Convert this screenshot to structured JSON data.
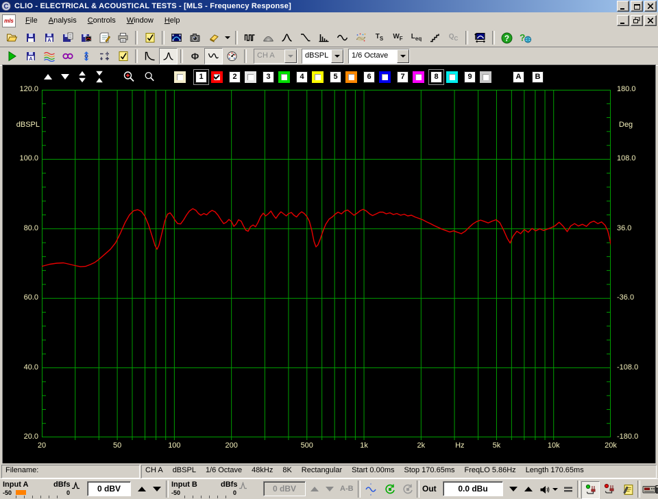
{
  "titlebar": {
    "title": "CLIO - ELECTRICAL & ACOUSTICAL TESTS - [MLS - Frequency Response]",
    "logo_glyph": "C"
  },
  "menu": {
    "window_icon_label": "mls",
    "items": [
      "File",
      "Analysis",
      "Controls",
      "Window",
      "Help"
    ]
  },
  "toolbar_main": {
    "save_a_letter": "A",
    "ts": {
      "main": "T",
      "sub": "S"
    },
    "wf": {
      "main": "W",
      "sub": "F"
    },
    "leq": {
      "main": "L",
      "sub": "eq"
    },
    "qc": {
      "main": "Q",
      "sub": "C"
    },
    "help_glyph": "?",
    "help_web_glyph": "?"
  },
  "toolbar_mls": {
    "phase_glyph": "Φ",
    "channel": "CH A",
    "unit": "dBSPL",
    "smoothing": "1/6 Octave"
  },
  "graph_toolbar": {
    "overlay_color": "#f2ecca",
    "curves": [
      {
        "label": "1",
        "color": "#ff0000",
        "checked": true,
        "selected": true
      },
      {
        "label": "2",
        "color": "#e8e8e8",
        "checked": false,
        "selected": false
      },
      {
        "label": "3",
        "color": "#00dd00",
        "checked": false,
        "selected": false
      },
      {
        "label": "4",
        "color": "#ffff00",
        "checked": false,
        "selected": false
      },
      {
        "label": "5",
        "color": "#ff8800",
        "checked": false,
        "selected": false
      },
      {
        "label": "6",
        "color": "#0000ee",
        "checked": false,
        "selected": false
      },
      {
        "label": "7",
        "color": "#ff00ff",
        "checked": false,
        "selected": false
      },
      {
        "label": "8",
        "color": "#00eeee",
        "checked": false,
        "selected": true
      },
      {
        "label": "9",
        "color": "#c8c8c8",
        "checked": false,
        "selected": false
      }
    ],
    "ab_buttons": [
      "A",
      "B"
    ]
  },
  "chart_data": {
    "type": "line",
    "title": "MLS - Frequency Response",
    "x_scale": "log",
    "xlim": [
      20,
      20000
    ],
    "ylim": [
      20,
      120
    ],
    "y2lim": [
      -180,
      180
    ],
    "xlabel": "Hz",
    "ylabel": "dBSPL",
    "y2label": "Deg",
    "grid": true,
    "grid_color": "#00a000",
    "label_color": "#f5f1bc",
    "background": "#000000",
    "y_ticks": [
      {
        "v": 120,
        "label": "120.0"
      },
      {
        "v": 100,
        "label": "100.0"
      },
      {
        "v": 80,
        "label": "80.0"
      },
      {
        "v": 60,
        "label": "60.0"
      },
      {
        "v": 40,
        "label": "40.0"
      },
      {
        "v": 20,
        "label": "20.0"
      }
    ],
    "y2_ticks": [
      {
        "v": 180,
        "label": "180.0"
      },
      {
        "v": 108,
        "label": "108.0"
      },
      {
        "v": 36,
        "label": "36.0"
      },
      {
        "v": -36,
        "label": "-36.0"
      },
      {
        "v": -108,
        "label": "-108.0"
      },
      {
        "v": -180,
        "label": "-180.0"
      }
    ],
    "x_ticks": [
      {
        "v": 20,
        "label": "20"
      },
      {
        "v": 50,
        "label": "50"
      },
      {
        "v": 100,
        "label": "100"
      },
      {
        "v": 200,
        "label": "200"
      },
      {
        "v": 500,
        "label": "500"
      },
      {
        "v": 1000,
        "label": "1k"
      },
      {
        "v": 2000,
        "label": "2k"
      },
      {
        "v": 5000,
        "label": "5k"
      },
      {
        "v": 10000,
        "label": "10k"
      },
      {
        "v": 20000,
        "label": "20k"
      }
    ],
    "x_unit_label_freq": 3200,
    "series": [
      {
        "name": "MLS frequency response (curve 1)",
        "color": "#e80000",
        "points": [
          [
            20,
            69.2
          ],
          [
            21,
            69.5
          ],
          [
            22,
            69.8
          ],
          [
            24,
            70.1
          ],
          [
            26,
            70.2
          ],
          [
            28,
            69.8
          ],
          [
            30,
            69.4
          ],
          [
            32,
            69.1
          ],
          [
            34,
            69.2
          ],
          [
            36,
            69.7
          ],
          [
            38,
            70.3
          ],
          [
            40,
            71.2
          ],
          [
            43,
            72.7
          ],
          [
            46,
            74.1
          ],
          [
            49,
            76.0
          ],
          [
            52,
            78.8
          ],
          [
            55,
            81.8
          ],
          [
            58,
            84.0
          ],
          [
            61,
            85.2
          ],
          [
            64,
            85.5
          ],
          [
            67,
            85.0
          ],
          [
            70,
            83.6
          ],
          [
            73,
            81.2
          ],
          [
            76,
            78.2
          ],
          [
            79,
            75.2
          ],
          [
            81,
            74.1
          ],
          [
            83,
            75.3
          ],
          [
            86,
            78.8
          ],
          [
            89,
            82.2
          ],
          [
            92,
            84.2
          ],
          [
            95,
            84.6
          ],
          [
            98,
            83.6
          ],
          [
            101,
            82.4
          ],
          [
            104,
            81.5
          ],
          [
            108,
            81.4
          ],
          [
            112,
            82.6
          ],
          [
            116,
            84.0
          ],
          [
            120,
            85.1
          ],
          [
            125,
            85.8
          ],
          [
            130,
            85.3
          ],
          [
            134,
            84.4
          ],
          [
            138,
            83.9
          ],
          [
            143,
            84.4
          ],
          [
            148,
            84.0
          ],
          [
            153,
            84.8
          ],
          [
            158,
            85.3
          ],
          [
            164,
            84.9
          ],
          [
            170,
            83.9
          ],
          [
            176,
            82.6
          ],
          [
            182,
            81.5
          ],
          [
            188,
            81.9
          ],
          [
            194,
            82.7
          ],
          [
            200,
            82.1
          ],
          [
            206,
            80.7
          ],
          [
            212,
            81.4
          ],
          [
            218,
            82.6
          ],
          [
            225,
            82.2
          ],
          [
            231,
            80.9
          ],
          [
            238,
            79.6
          ],
          [
            245,
            79.3
          ],
          [
            252,
            80.6
          ],
          [
            260,
            81.1
          ],
          [
            268,
            80.6
          ],
          [
            276,
            81.8
          ],
          [
            285,
            83.5
          ],
          [
            294,
            84.5
          ],
          [
            303,
            83.7
          ],
          [
            313,
            84.3
          ],
          [
            323,
            85.1
          ],
          [
            333,
            83.9
          ],
          [
            343,
            83.0
          ],
          [
            354,
            84.1
          ],
          [
            365,
            84.9
          ],
          [
            377,
            84.3
          ],
          [
            389,
            83.7
          ],
          [
            401,
            84.4
          ],
          [
            414,
            84.7
          ],
          [
            427,
            83.9
          ],
          [
            441,
            83.4
          ],
          [
            455,
            84.3
          ],
          [
            469,
            84.9
          ],
          [
            484,
            84.4
          ],
          [
            500,
            83.5
          ],
          [
            515,
            82.2
          ],
          [
            530,
            79.6
          ],
          [
            545,
            76.4
          ],
          [
            558,
            74.8
          ],
          [
            572,
            75.4
          ],
          [
            590,
            77.3
          ],
          [
            610,
            79.6
          ],
          [
            630,
            81.4
          ],
          [
            655,
            82.8
          ],
          [
            680,
            83.4
          ],
          [
            705,
            84.2
          ],
          [
            730,
            84.8
          ],
          [
            760,
            84.3
          ],
          [
            790,
            85.1
          ],
          [
            820,
            85.4
          ],
          [
            850,
            84.7
          ],
          [
            885,
            83.9
          ],
          [
            920,
            84.5
          ],
          [
            955,
            85.2
          ],
          [
            990,
            85.6
          ],
          [
            1030,
            85.1
          ],
          [
            1070,
            84.3
          ],
          [
            1110,
            83.8
          ],
          [
            1160,
            84.3
          ],
          [
            1210,
            84.8
          ],
          [
            1260,
            84.8
          ],
          [
            1310,
            84.3
          ],
          [
            1370,
            84.6
          ],
          [
            1430,
            84.1
          ],
          [
            1490,
            84.4
          ],
          [
            1560,
            83.9
          ],
          [
            1630,
            84.2
          ],
          [
            1700,
            83.7
          ],
          [
            1780,
            83.9
          ],
          [
            1860,
            83.4
          ],
          [
            1950,
            83.0
          ],
          [
            2040,
            82.6
          ],
          [
            2140,
            82.0
          ],
          [
            2240,
            81.5
          ],
          [
            2350,
            80.9
          ],
          [
            2460,
            80.4
          ],
          [
            2580,
            79.9
          ],
          [
            2700,
            79.5
          ],
          [
            2830,
            79.1
          ],
          [
            2970,
            79.4
          ],
          [
            3110,
            79.0
          ],
          [
            3260,
            78.6
          ],
          [
            3420,
            79.3
          ],
          [
            3580,
            80.4
          ],
          [
            3750,
            81.4
          ],
          [
            3930,
            82.1
          ],
          [
            4120,
            82.5
          ],
          [
            4320,
            82.1
          ],
          [
            4520,
            81.7
          ],
          [
            4740,
            82.2
          ],
          [
            4970,
            82.6
          ],
          [
            5200,
            81.8
          ],
          [
            5450,
            79.6
          ],
          [
            5700,
            77.2
          ],
          [
            5900,
            75.9
          ],
          [
            6100,
            77.8
          ],
          [
            6400,
            79.3
          ],
          [
            6700,
            78.6
          ],
          [
            7000,
            79.8
          ],
          [
            7350,
            79.0
          ],
          [
            7700,
            80.1
          ],
          [
            8050,
            79.4
          ],
          [
            8450,
            80.0
          ],
          [
            8850,
            79.5
          ],
          [
            9250,
            79.9
          ],
          [
            9700,
            80.3
          ],
          [
            10200,
            80.9
          ],
          [
            10700,
            81.9
          ],
          [
            11200,
            80.8
          ],
          [
            11800,
            79.2
          ],
          [
            12300,
            80.8
          ],
          [
            12900,
            81.5
          ],
          [
            13500,
            80.8
          ],
          [
            14200,
            81.3
          ],
          [
            14900,
            80.7
          ],
          [
            15600,
            81.8
          ],
          [
            16300,
            82.2
          ],
          [
            17100,
            81.5
          ],
          [
            17900,
            82.0
          ],
          [
            18700,
            81.0
          ],
          [
            19300,
            79.4
          ],
          [
            19700,
            77.4
          ],
          [
            20100,
            75.2
          ],
          [
            20400,
            73.6
          ]
        ]
      }
    ]
  },
  "statusbar": {
    "filename_label": "Filename:",
    "info": [
      "CH A",
      "dBSPL",
      "1/6 Octave",
      "48kHz",
      "8K",
      "Rectangular",
      "Start 0.00ms",
      "Stop 170.65ms",
      "FreqLO 5.86Hz",
      "Length 170.65ms"
    ]
  },
  "bottombar": {
    "input_a": {
      "label": "Input A",
      "unit": "dBfs",
      "value": "0 dBV",
      "meter_min": "-50",
      "meter_max": "0"
    },
    "input_b": {
      "label": "Input B",
      "unit": "dBfs",
      "value": "0 dBV",
      "meter_min": "-50",
      "meter_max": "0",
      "ab_label": "A-B"
    },
    "out": {
      "label": "Out",
      "value": "0.0 dBu"
    }
  }
}
